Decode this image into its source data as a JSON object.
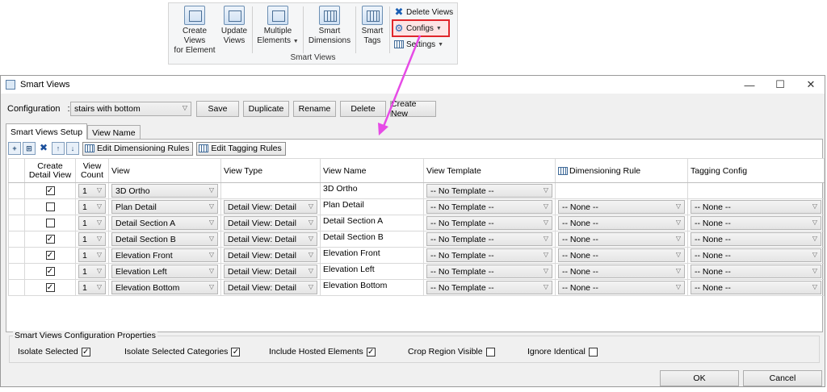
{
  "ribbon": {
    "buttons": [
      {
        "line1": "Create Views",
        "line2": "for Element"
      },
      {
        "line1": "Update",
        "line2": "Views"
      },
      {
        "line1": "Multiple",
        "line2": "Elements"
      },
      {
        "line1": "Smart",
        "line2": "Dimensions"
      },
      {
        "line1": "Smart",
        "line2": "Tags"
      }
    ],
    "delete_views": "Delete Views",
    "configs": "Configs",
    "settings": "Settings",
    "group_label": "Smart Views",
    "highlight_color": "#e0262b",
    "arrow_color": "#e64be6"
  },
  "window": {
    "title": "Smart Views",
    "minimize": "—",
    "maximize": "☐",
    "close": "✕"
  },
  "config": {
    "label": "Configuration",
    "colon": ":",
    "selected": "stairs with bottom",
    "buttons": {
      "save": "Save",
      "duplicate": "Duplicate",
      "rename": "Rename",
      "delete": "Delete",
      "create_new": "Create New"
    }
  },
  "tabs": [
    {
      "label": "Smart Views Setup",
      "active": true
    },
    {
      "label": "View Name",
      "active": false
    }
  ],
  "toolbar": {
    "edit_dimensioning_rules": "Edit Dimensioning Rules",
    "edit_tagging_rules": "Edit Tagging Rules"
  },
  "grid": {
    "headers": {
      "create_l1": "Create",
      "create_l2": "Detail View",
      "count_l1": "View",
      "count_l2": "Count",
      "view": "View",
      "view_type": "View Type",
      "view_name": "View Name",
      "view_template": "View Template",
      "dimensioning_rule": "Dimensioning Rule",
      "tagging_config": "Tagging Config"
    },
    "rows": [
      {
        "checked": "✓",
        "count": "1",
        "view": "3D Ortho",
        "view_type": "",
        "view_name": "3D Ortho",
        "template": "-- No Template --",
        "dim": "",
        "tag": ""
      },
      {
        "checked": "",
        "count": "1",
        "view": "Plan Detail",
        "view_type": "Detail View: Detail",
        "view_name": "Plan Detail",
        "template": "-- No Template --",
        "dim": "-- None --",
        "tag": "-- None --"
      },
      {
        "checked": "",
        "count": "1",
        "view": "Detail Section A",
        "view_type": "Detail View: Detail",
        "view_name": "Detail Section A",
        "template": "-- No Template --",
        "dim": "-- None --",
        "tag": "-- None --"
      },
      {
        "checked": "✓",
        "count": "1",
        "view": "Detail Section B",
        "view_type": "Detail View: Detail",
        "view_name": "Detail Section B",
        "template": "-- No Template --",
        "dim": "-- None --",
        "tag": "-- None --"
      },
      {
        "checked": "✓",
        "count": "1",
        "view": "Elevation Front",
        "view_type": "Detail View: Detail",
        "view_name": "Elevation Front",
        "template": "-- No Template --",
        "dim": "-- None --",
        "tag": "-- None --"
      },
      {
        "checked": "✓",
        "count": "1",
        "view": "Elevation Left",
        "view_type": "Detail View: Detail",
        "view_name": "Elevation Left",
        "template": "-- No Template --",
        "dim": "-- None --",
        "tag": "-- None --"
      },
      {
        "checked": "✓",
        "count": "1",
        "view": "Elevation Bottom",
        "view_type": "Detail View: Detail",
        "view_name": "Elevation Bottom",
        "template": "-- No Template --",
        "dim": "-- None --",
        "tag": "-- None --"
      }
    ]
  },
  "properties": {
    "legend": "Smart Views Configuration Properties",
    "items": [
      {
        "label": "Isolate Selected",
        "checked": "✓"
      },
      {
        "label": "Isolate Selected Categories",
        "checked": "✓"
      },
      {
        "label": "Include Hosted Elements",
        "checked": "✓"
      },
      {
        "label": "Crop Region Visible",
        "checked": ""
      },
      {
        "label": "Ignore Identical",
        "checked": ""
      }
    ]
  },
  "footer": {
    "ok": "OK",
    "cancel": "Cancel"
  }
}
